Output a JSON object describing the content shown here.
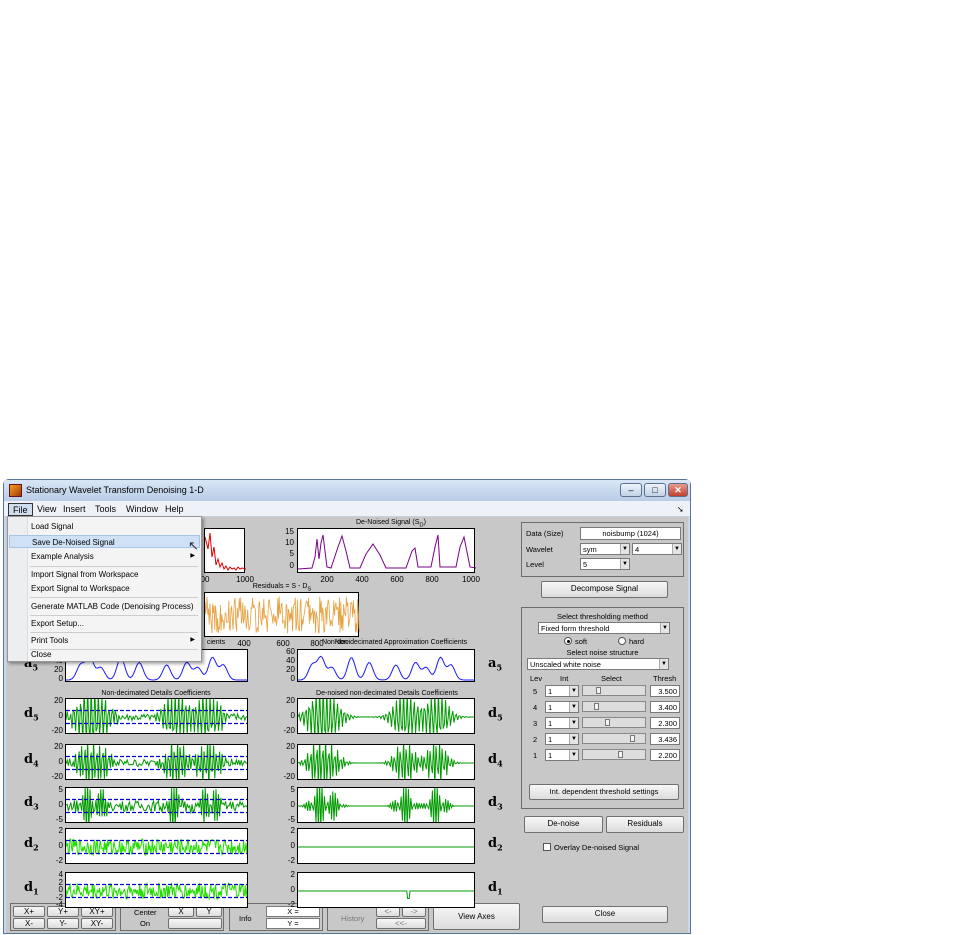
{
  "window": {
    "title": "Stationary Wavelet Transform Denoising 1-D",
    "controls": {
      "minimize": "–",
      "maximize": "□",
      "close": "✕"
    }
  },
  "menubar": [
    "File",
    "View",
    "Insert",
    "Tools",
    "Window",
    "Help"
  ],
  "file_menu": {
    "items": [
      "Load Signal",
      "Save De-Noised Signal",
      "Example Analysis",
      "Import Signal from Workspace",
      "Export Signal to Workspace",
      "Generate MATLAB Code (Denoising Process)",
      "Export Setup...",
      "Print Tools",
      "Close"
    ],
    "highlighted": "Save De-Noised Signal",
    "submenu_items": [
      "Example Analysis",
      "Print Tools"
    ]
  },
  "plots": {
    "denoised_title": "De-Noised Signal (S",
    "denoised_title_sub": "D",
    "denoised_title_end": ")",
    "residuals_title": "Residuals = S - D",
    "residuals_title_sub": "S",
    "left_coeff_title_fragment": "cients",
    "approx_title": "Non-decimated Approximation Coefficients",
    "approx_title_overlap": "Non-deci",
    "left_details_title": "Non-decimated Details Coefficients",
    "right_details_title": "De-noised non-decimated Details Coefficients",
    "fragment_axes": [
      "00",
      "1000"
    ],
    "res_axes": [
      "400",
      "600",
      "800"
    ],
    "x_ticks": [
      "200",
      "400",
      "600",
      "800",
      "1000"
    ],
    "den_y_ticks": [
      "15",
      "10",
      "5",
      "0"
    ],
    "rows": [
      {
        "label": "a",
        "sub": "5",
        "y_ticks_left": [
          "60",
          "40",
          "20",
          "0"
        ],
        "y_ticks_right": [
          "60",
          "40",
          "20",
          "0"
        ]
      },
      {
        "label": "d",
        "sub": "5",
        "y_ticks_left": [
          "20",
          "0",
          "-20"
        ],
        "y_ticks_right": [
          "20",
          "0",
          "-20"
        ]
      },
      {
        "label": "d",
        "sub": "4",
        "y_ticks_left": [
          "20",
          "0",
          "-20"
        ],
        "y_ticks_right": [
          "20",
          "0",
          "-20"
        ]
      },
      {
        "label": "d",
        "sub": "3",
        "y_ticks_left": [
          "5",
          "0",
          "-5"
        ],
        "y_ticks_right": [
          "5",
          "0",
          "-5"
        ]
      },
      {
        "label": "d",
        "sub": "2",
        "y_ticks_left": [
          "2",
          "0",
          "-2"
        ],
        "y_ticks_right": [
          "2",
          "0",
          "-2"
        ]
      },
      {
        "label": "d",
        "sub": "1",
        "y_ticks_left": [
          "4",
          "2",
          "0",
          "-2",
          "-4"
        ],
        "y_ticks_right": [
          "2",
          "0",
          "-2"
        ]
      }
    ]
  },
  "right_panel": {
    "data_label": "Data  (Size)",
    "data_value": "noisbump  (1024)",
    "wavelet_label": "Wavelet",
    "wavelet_family": "sym",
    "wavelet_order": "4",
    "level_label": "Level",
    "level_value": "5",
    "decompose_button": "Decompose Signal",
    "threshold_method_title": "Select thresholding method",
    "threshold_method": "Fixed form threshold",
    "soft_label": "soft",
    "hard_label": "hard",
    "soft_selected": true,
    "noise_structure_title": "Select noise structure",
    "noise_structure": "Unscaled white noise",
    "col_lev": "Lev",
    "col_int": "Int",
    "col_select": "Select",
    "col_thresh": "Thresh",
    "levels": [
      {
        "lev": "5",
        "int": "1",
        "thresh": "3.500",
        "pos": 0.15
      },
      {
        "lev": "4",
        "int": "1",
        "thresh": "3.400",
        "pos": 0.1
      },
      {
        "lev": "3",
        "int": "1",
        "thresh": "2.300",
        "pos": 0.35
      },
      {
        "lev": "2",
        "int": "1",
        "thresh": "3.436",
        "pos": 0.9
      },
      {
        "lev": "1",
        "int": "1",
        "thresh": "2.200",
        "pos": 0.62
      }
    ],
    "interval_button": "Int. dependent threshold settings",
    "denoise_button": "De-noise",
    "residuals_button": "Residuals",
    "overlay_label": "Overlay De-noised Signal",
    "close_button": "Close"
  },
  "bottom_bar": {
    "zoom_buttons": [
      "X+",
      "Y+",
      "XY+",
      "X-",
      "Y-",
      "XY-"
    ],
    "center_label": "Center",
    "center_state": "On",
    "center_x": "X",
    "center_y": "Y",
    "info_label": "Info",
    "info_x": "X =",
    "info_y": "Y =",
    "history_label": "History",
    "history_back": "<-",
    "history_fwd": "->",
    "history_first": "<<-",
    "view_axes": "View Axes"
  },
  "colors": {
    "denoised": "#7a008a",
    "original": "#e00000",
    "residuals": "#e8a040",
    "approx": "#1a1aff",
    "details": "#009a00",
    "details_noisy": "#22dd00",
    "threshold": "#0000cc"
  }
}
